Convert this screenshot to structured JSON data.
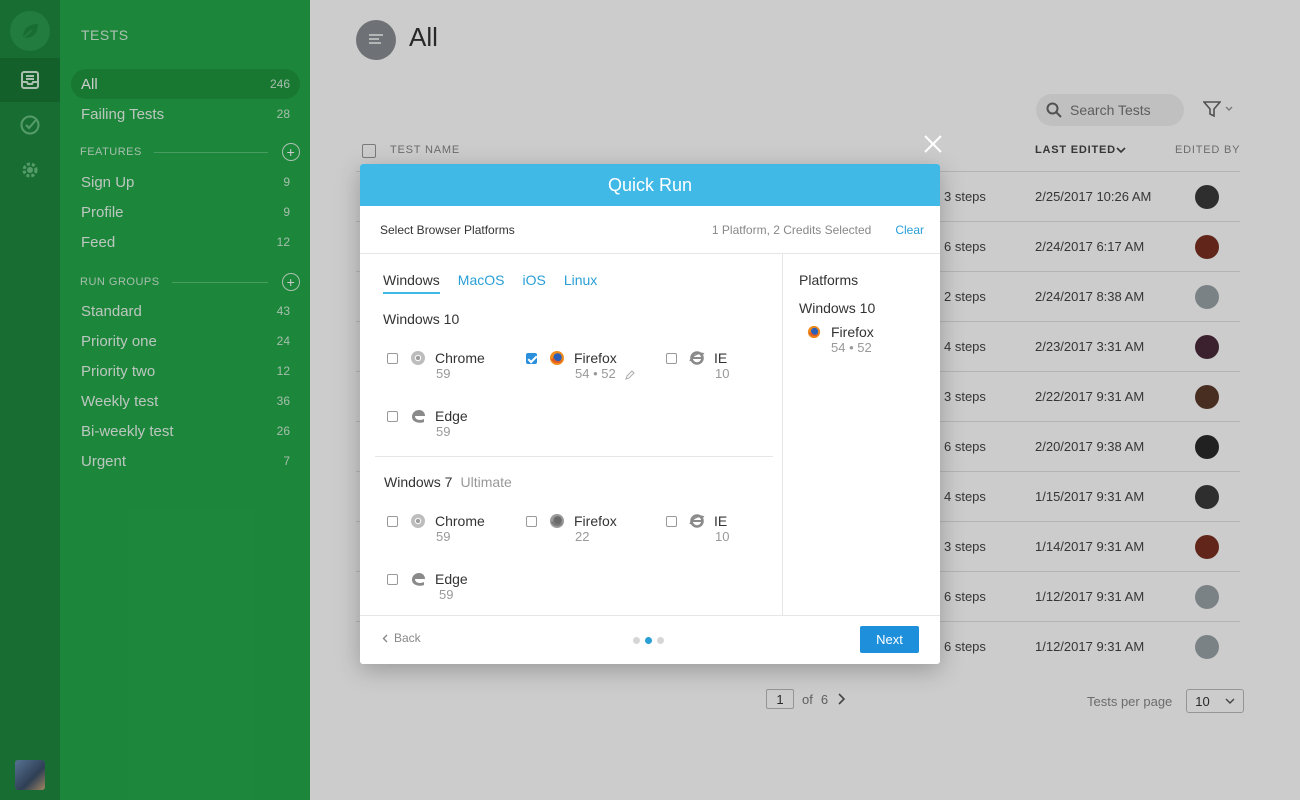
{
  "sidebar": {
    "title": "TESTS",
    "items": [
      {
        "label": "All",
        "count": "246"
      },
      {
        "label": "Failing Tests",
        "count": "28"
      }
    ],
    "features": {
      "heading": "FEATURES",
      "items": [
        {
          "label": "Sign Up",
          "count": "9"
        },
        {
          "label": "Profile",
          "count": "9"
        },
        {
          "label": "Feed",
          "count": "12"
        }
      ]
    },
    "run_groups": {
      "heading": "RUN GROUPS",
      "items": [
        {
          "label": "Standard",
          "count": "43"
        },
        {
          "label": "Priority one",
          "count": "24"
        },
        {
          "label": "Priority two",
          "count": "12"
        },
        {
          "label": "Weekly test",
          "count": "36"
        },
        {
          "label": "Bi-weekly test",
          "count": "26"
        },
        {
          "label": "Urgent",
          "count": "7"
        }
      ]
    },
    "add_glyph": "+"
  },
  "main": {
    "title": "All",
    "search_placeholder": "Search Tests",
    "columns": {
      "test_name": "TEST NAME",
      "last_edited": "LAST EDITED",
      "edited_by": "EDITED BY"
    },
    "rows": [
      {
        "steps": "3 steps",
        "date": "2/25/2017 10:26 AM"
      },
      {
        "steps": "6 steps",
        "date": "2/24/2017 6:17 AM"
      },
      {
        "steps": "2 steps",
        "date": "2/24/2017 8:38 AM"
      },
      {
        "steps": "4 steps",
        "date": "2/23/2017 3:31 AM"
      },
      {
        "steps": "3 steps",
        "date": "2/22/2017 9:31 AM"
      },
      {
        "steps": "6 steps",
        "date": "2/20/2017 9:38 AM"
      },
      {
        "steps": "4 steps",
        "date": "1/15/2017 9:31 AM"
      },
      {
        "steps": "3 steps",
        "date": "1/14/2017 9:31 AM"
      },
      {
        "steps": "6 steps",
        "date": "1/12/2017 9:31 AM"
      },
      {
        "steps": "6 steps",
        "date": "1/12/2017 9:31 AM"
      }
    ],
    "pagination": {
      "current": "1",
      "of_label": "of",
      "total": "6",
      "per_page_label": "Tests per page",
      "per_page_value": "10"
    }
  },
  "modal": {
    "title": "Quick Run",
    "select_label": "Select Browser Platforms",
    "summary": "1 Platform, 2 Credits Selected",
    "clear_label": "Clear",
    "tabs": [
      "Windows",
      "MacOS",
      "iOS",
      "Linux"
    ],
    "active_tab": "Windows",
    "groups": [
      {
        "os": "Windows 10",
        "edition": "",
        "browsers": [
          {
            "name": "Chrome",
            "version": "59",
            "checked": false,
            "icon": "chrome-icon"
          },
          {
            "name": "Firefox",
            "version": "54 • 52",
            "checked": true,
            "icon": "firefox-icon"
          },
          {
            "name": "IE",
            "version": "10",
            "checked": false,
            "icon": "ie-icon"
          },
          {
            "name": "Edge",
            "version": "59",
            "checked": false,
            "icon": "edge-icon"
          }
        ]
      },
      {
        "os": "Windows 7",
        "edition": "Ultimate",
        "browsers": [
          {
            "name": "Chrome",
            "version": "59",
            "checked": false,
            "icon": "chrome-icon"
          },
          {
            "name": "Firefox",
            "version": "22",
            "checked": false,
            "icon": "firefox-icon"
          },
          {
            "name": "IE",
            "version": "10",
            "checked": false,
            "icon": "ie-icon"
          },
          {
            "name": "Edge",
            "version": "59",
            "checked": false,
            "icon": "edge-icon"
          }
        ]
      }
    ],
    "platforms_panel": {
      "title": "Platforms",
      "os": "Windows 10",
      "browser": "Firefox",
      "version": "54 • 52"
    },
    "back_label": "Back",
    "next_label": "Next",
    "step": {
      "current": 2,
      "total": 3
    }
  },
  "colors": {
    "rail": "#1f8a3f",
    "sidebar": "#24a94a",
    "modal_header": "#40b9e6",
    "primary_button": "#1e90db"
  }
}
